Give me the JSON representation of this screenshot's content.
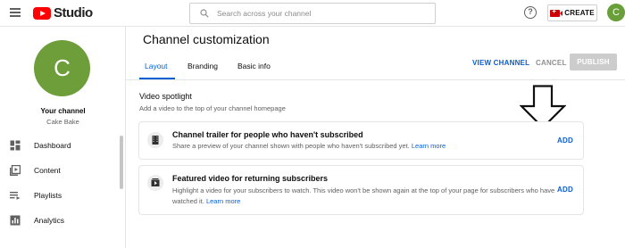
{
  "topbar": {
    "logo_text": "Studio",
    "search_placeholder": "Search across your channel",
    "help_glyph": "?",
    "create_label": "CREATE",
    "avatar_letter": "C"
  },
  "sidebar": {
    "avatar_letter": "C",
    "channel_label": "Your channel",
    "channel_name": "Cake Bake",
    "items": [
      {
        "label": "Dashboard",
        "icon": "dashboard-icon"
      },
      {
        "label": "Content",
        "icon": "content-icon"
      },
      {
        "label": "Playlists",
        "icon": "playlists-icon"
      },
      {
        "label": "Analytics",
        "icon": "analytics-icon"
      }
    ]
  },
  "main": {
    "title": "Channel customization",
    "tabs": [
      {
        "label": "Layout",
        "active": true
      },
      {
        "label": "Branding",
        "active": false
      },
      {
        "label": "Basic info",
        "active": false
      }
    ],
    "actions": {
      "view_channel": "VIEW CHANNEL",
      "cancel": "CANCEL",
      "publish": "PUBLISH"
    },
    "section": {
      "title": "Video spotlight",
      "subtitle": "Add a video to the top of your channel homepage",
      "cards": [
        {
          "title": "Channel trailer for people who haven't subscribed",
          "description": "Share a preview of your channel shown with people who haven't subscribed yet.",
          "link": "Learn more",
          "add_label": "ADD",
          "icon": "film-icon"
        },
        {
          "title": "Featured video for returning subscribers",
          "description_line1": "Highlight a video for your subscribers to watch. This video won't be shown again at the top of your page for subscribers who have",
          "description_line2": "watched it.",
          "link": "Learn more",
          "add_label": "ADD",
          "icon": "featured-video-icon"
        }
      ]
    }
  },
  "colors": {
    "accent_blue": "#065fd4",
    "brand_red": "#ff0000",
    "avatar_green": "#6d9e3a",
    "publish_disabled": "#cccccc"
  }
}
